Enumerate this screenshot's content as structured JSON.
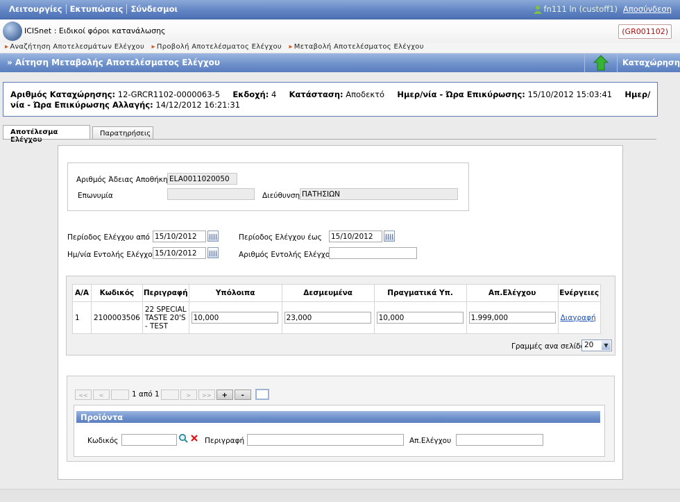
{
  "menu": [
    "Λειτουργίες",
    "Εκτυπώσεις",
    "Σύνδεσμοι"
  ],
  "user": {
    "name": "fn111 ln (custoff1)",
    "logout": "Αποσύνδεση"
  },
  "app": {
    "title": "ICISnet : Ειδικοί φόροι κατανάλωσης",
    "code": "(GR001102)"
  },
  "breadcrumbs": [
    "Αναζήτηση Αποτελεσμάτων Ελέγχου",
    "Προβολή Αποτελέσματος Ελέγχου",
    "Μεταβολή Αποτελέσματος Ελέγχου"
  ],
  "section": {
    "title": "» Αίτηση Μεταβολής Αποτελέσματος Ελέγχου",
    "save_label": "Καταχώρηση"
  },
  "info": {
    "reg_label": "Αριθμός Καταχώρησης:",
    "reg_value": "12-GRCR1102-0000063-5",
    "version_label": "Εκδοχή:",
    "version_value": "4",
    "status_label": "Κατάσταση:",
    "status_value": "Αποδεκτό",
    "confirm_label": "Ημερ/νία - Ώρα Επικύρωσης:",
    "confirm_value": "15/10/2012 15:03:41",
    "change_label": "Ημερ/νία - Ώρα Επικύρωσης Αλλαγής:",
    "change_value": "14/12/2012 16:21:31"
  },
  "tabs": [
    "Αποτέλεσμα Ελέγχου",
    "Παρατηρήσεις"
  ],
  "warehouse": {
    "license_label": "Αριθμός Άδειας Αποθήκης",
    "license_value": "ELA0011020050",
    "name_label": "Επωνυμία",
    "name_value": "",
    "address_label": "Διεύθυνση",
    "address_value": "ΠΑΤΗΣΙΩΝ"
  },
  "period": {
    "from_label": "Περίοδος Ελέγχου από",
    "from_value": "15/10/2012",
    "to_label": "Περίοδος Ελέγχου έως",
    "to_value": "15/10/2012",
    "order_date_label": "Ημ/νία Εντολής Ελέγχου",
    "order_date_value": "15/10/2012",
    "order_no_label": "Αριθμός Εντολής Ελέγχου",
    "order_no_value": ""
  },
  "table": {
    "headers": [
      "Α/Α",
      "Κωδικός",
      "Περιγραφή",
      "Υπόλοιπα",
      "Δεσμευμένα",
      "Πραγματικά Υπ.",
      "Απ.Ελέγχου",
      "Ενέργειες"
    ],
    "rows": [
      {
        "aa": "1",
        "code": "2100003506",
        "desc": "22 SPECIAL TASTE 20'S - TEST",
        "balance": "10,000",
        "reserved": "23,000",
        "actual": "10,000",
        "result": "1.999,000",
        "action": "Διαγραφή"
      }
    ]
  },
  "rows_per_page": {
    "label": "Γραμμές ανα σελίδα:",
    "value": "20"
  },
  "pager": {
    "first": "<<",
    "prev": "<",
    "page_text": "1 από 1",
    "next": ">",
    "last": ">>",
    "add": "+",
    "remove": "-"
  },
  "products": {
    "title": "Προϊόντα",
    "code_label": "Κωδικός",
    "code_value": "",
    "desc_label": "Περιγραφή",
    "desc_value": "",
    "result_label": "Απ.Ελέγχου",
    "result_value": ""
  }
}
